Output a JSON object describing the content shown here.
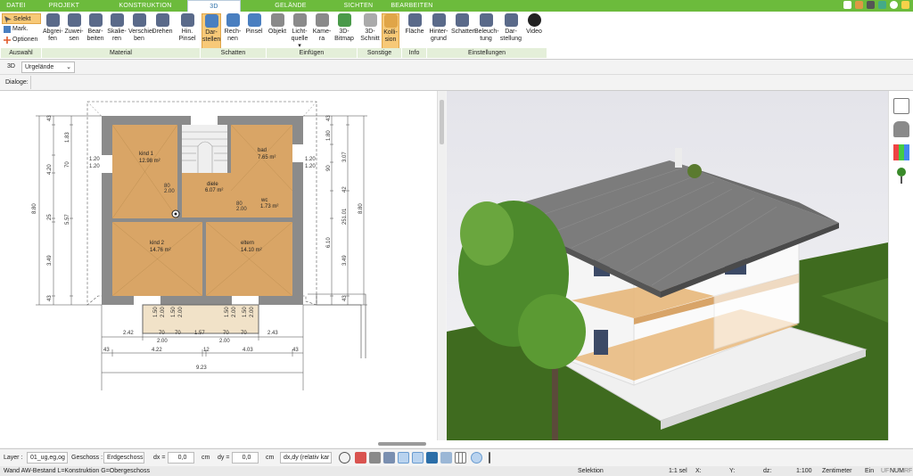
{
  "tabs": [
    "DATEI",
    "PROJEKT",
    "KONSTRUKTION",
    "3D",
    "GELÄNDE",
    "SICHTEN",
    "BEARBEITEN"
  ],
  "auswahl": {
    "selekt": "Selekt",
    "mark": "Mark.",
    "optionen": "Optionen"
  },
  "ribbon_buttons": [
    {
      "l1": "Abgrei-",
      "l2": "fen"
    },
    {
      "l1": "Zuwei-",
      "l2": "sen"
    },
    {
      "l1": "Bear-",
      "l2": "beiten"
    },
    {
      "l1": "Skalie-",
      "l2": "ren"
    },
    {
      "l1": "Verschie-",
      "l2": "ben"
    },
    {
      "l1": "Drehen",
      "l2": ""
    },
    {
      "l1": "Hin.",
      "l2": "Pinsel"
    },
    {
      "l1": "Dar-",
      "l2": "stellen"
    },
    {
      "l1": "Rech-",
      "l2": "nen"
    },
    {
      "l1": "Pinsel",
      "l2": ""
    },
    {
      "l1": "Objekt",
      "l2": ""
    },
    {
      "l1": "Licht-",
      "l2": "quelle ▾"
    },
    {
      "l1": "Kame-",
      "l2": "ra"
    },
    {
      "l1": "3D-",
      "l2": "Bitmap"
    },
    {
      "l1": "3D-",
      "l2": "Schnitt"
    },
    {
      "l1": "Kolli-",
      "l2": "sion"
    },
    {
      "l1": "Fläche",
      "l2": ""
    },
    {
      "l1": "Hinter-",
      "l2": "grund"
    },
    {
      "l1": "Schatten",
      "l2": ""
    },
    {
      "l1": "Beleuch-",
      "l2": "tung"
    },
    {
      "l1": "Dar-",
      "l2": "stellung"
    },
    {
      "l1": "Video",
      "l2": ""
    }
  ],
  "groups": [
    "Auswahl",
    "Material",
    "Schatten",
    "Einfügen",
    "Sonstige",
    "Info",
    "Einstellungen"
  ],
  "view_bar": {
    "mode": "3D",
    "terrain": "Urgelände"
  },
  "dialog_label": "Dialoge:",
  "rooms": [
    {
      "name": "kind 1",
      "area": "12.98 m²"
    },
    {
      "name": "bad",
      "area": "7.65 m²"
    },
    {
      "name": "diele",
      "area": "6.07 m²"
    },
    {
      "name": "wc",
      "area": "1.73 m²"
    },
    {
      "name": "kind 2",
      "area": "14.76 m²"
    },
    {
      "name": "eltern",
      "area": "14.10 m²"
    }
  ],
  "dims": {
    "left_outer": "8.80",
    "left_a": [
      "43",
      "1.83",
      "4.20",
      "70",
      "25",
      "5.57",
      "3.49",
      "43"
    ],
    "left_win": [
      "1.20",
      "1.20"
    ],
    "right_outer": "8.80",
    "right_a": [
      "43",
      "1.80",
      "3.07",
      "42",
      "90",
      "6.10",
      "251.01",
      "3.49",
      "43"
    ],
    "right_win": [
      "1.20",
      "1.20"
    ],
    "bottom_row1": [
      "2.42",
      "70",
      "70",
      "1.57",
      "70",
      "70",
      "2.43"
    ],
    "bottom_row1b": [
      "2.00",
      "2.00"
    ],
    "bottom_row2": [
      "43",
      "4.22",
      "12",
      "4.03",
      "43"
    ],
    "bottom_total": "9.23",
    "door_w": [
      "80",
      "2.00",
      "80",
      "2.00"
    ],
    "balcony": [
      "1.50",
      "2.00",
      "1.50",
      "2.00",
      "1.50",
      "2.00",
      "1.50",
      "2.00"
    ]
  },
  "bottom": {
    "layer_label": "Layer :",
    "layer_value": "01_ug,eg,og",
    "geschoss_label": "Geschoss :",
    "geschoss_value": "Erdgeschoss",
    "dx_label": "dx =",
    "dx_value": "0,0",
    "dy_label": "dy =",
    "dy_value": "0,0",
    "unit": "cm",
    "mode_value": "dx,dy (relativ kar"
  },
  "status": {
    "left": "Wand AW-Bestand L=Konstruktion G=Obergeschoss",
    "selektion": "Selektion",
    "sel": "1:1 sel",
    "x": "X:",
    "y": "Y:",
    "dz": "dz:",
    "scale": "1:100",
    "unit": "Zentimeter",
    "ein": "Ein",
    "uf": "UF",
    "num": "NUM",
    "rf": "RF"
  },
  "colors": {
    "accent_green": "#6cbb3c",
    "ribbon_active": "#f7c978",
    "floor_wood": "#d9a566",
    "sky": "#e9e9ee",
    "grass": "#3f6b1f"
  }
}
